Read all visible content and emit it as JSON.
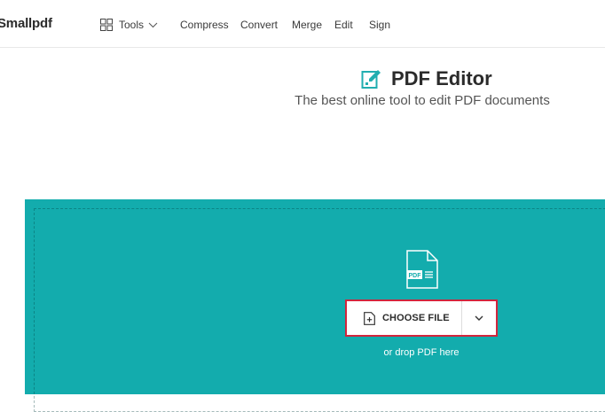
{
  "header": {
    "logo": "Smallpdf",
    "tools_label": "Tools",
    "nav": [
      "Compress",
      "Convert",
      "Merge",
      "Edit",
      "Sign"
    ]
  },
  "hero": {
    "title": "PDF Editor",
    "subtitle": "The best online tool to edit PDF documents"
  },
  "dropzone": {
    "file_badge": "PDF",
    "choose_label": "CHOOSE FILE",
    "hint": "or drop PDF here"
  },
  "colors": {
    "accent": "#13acad",
    "focus_border": "#d2253c",
    "title_icon": "#21aeb0"
  },
  "icons": {
    "tools": "grid-icon",
    "title": "edit-document-icon",
    "file": "pdf-file-icon",
    "choose": "add-file-icon",
    "dropdown": "chevron-down-icon"
  }
}
